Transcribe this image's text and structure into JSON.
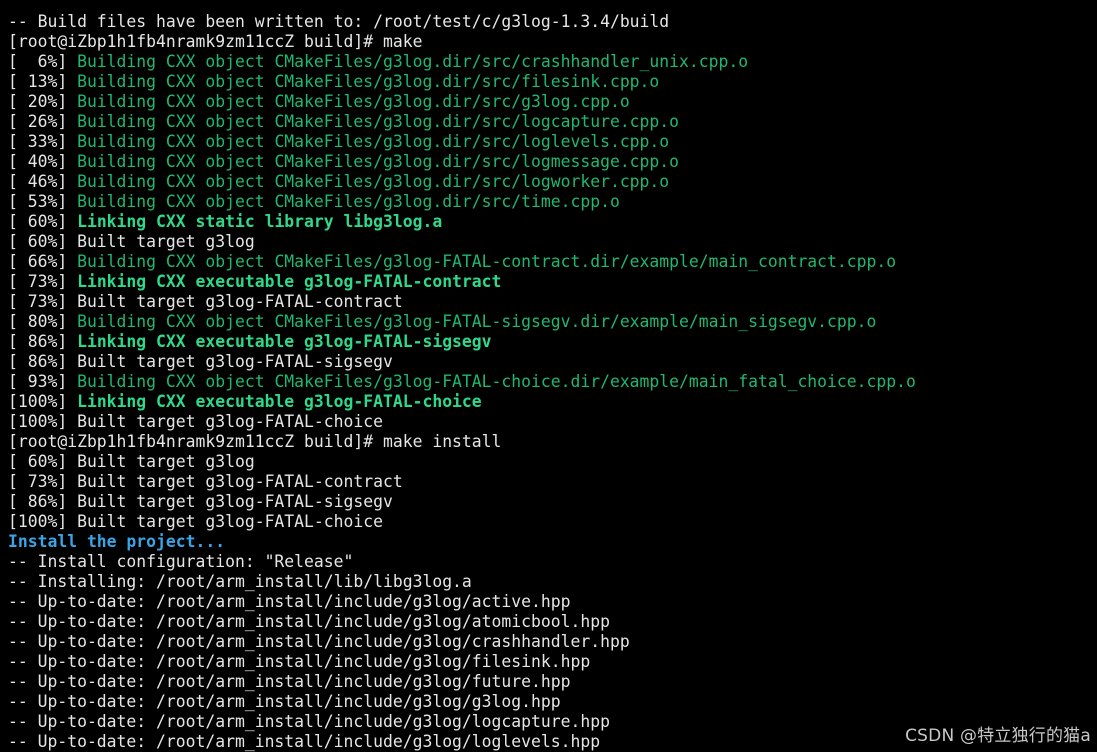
{
  "colors": {
    "background": "#000000",
    "normal": "#e6e6e6",
    "green": "#1fb870",
    "green_bold": "#2fd98a",
    "blue_bold": "#3aa5e6",
    "watermark": "#c8c8c8"
  },
  "watermark": "CSDN @特立独行的猫a",
  "lines": [
    {
      "segments": [
        {
          "text": "-- Build files have been written to: /root/test/c/g3log-1.3.4/build",
          "style": "normal"
        }
      ]
    },
    {
      "segments": [
        {
          "text": "[root@iZbp1h1fb4nramk9zm11ccZ build]# make",
          "style": "normal"
        }
      ]
    },
    {
      "segments": [
        {
          "text": "[  6%] ",
          "style": "normal"
        },
        {
          "text": "Building CXX object CMakeFiles/g3log.dir/src/crashhandler_unix.cpp.o",
          "style": "green"
        }
      ]
    },
    {
      "segments": [
        {
          "text": "[ 13%] ",
          "style": "normal"
        },
        {
          "text": "Building CXX object CMakeFiles/g3log.dir/src/filesink.cpp.o",
          "style": "green"
        }
      ]
    },
    {
      "segments": [
        {
          "text": "[ 20%] ",
          "style": "normal"
        },
        {
          "text": "Building CXX object CMakeFiles/g3log.dir/src/g3log.cpp.o",
          "style": "green"
        }
      ]
    },
    {
      "segments": [
        {
          "text": "[ 26%] ",
          "style": "normal"
        },
        {
          "text": "Building CXX object CMakeFiles/g3log.dir/src/logcapture.cpp.o",
          "style": "green"
        }
      ]
    },
    {
      "segments": [
        {
          "text": "[ 33%] ",
          "style": "normal"
        },
        {
          "text": "Building CXX object CMakeFiles/g3log.dir/src/loglevels.cpp.o",
          "style": "green"
        }
      ]
    },
    {
      "segments": [
        {
          "text": "[ 40%] ",
          "style": "normal"
        },
        {
          "text": "Building CXX object CMakeFiles/g3log.dir/src/logmessage.cpp.o",
          "style": "green"
        }
      ]
    },
    {
      "segments": [
        {
          "text": "[ 46%] ",
          "style": "normal"
        },
        {
          "text": "Building CXX object CMakeFiles/g3log.dir/src/logworker.cpp.o",
          "style": "green"
        }
      ]
    },
    {
      "segments": [
        {
          "text": "[ 53%] ",
          "style": "normal"
        },
        {
          "text": "Building CXX object CMakeFiles/g3log.dir/src/time.cpp.o",
          "style": "green"
        }
      ]
    },
    {
      "segments": [
        {
          "text": "[ 60%] ",
          "style": "normal"
        },
        {
          "text": "Linking CXX static library libg3log.a",
          "style": "green-bold"
        }
      ]
    },
    {
      "segments": [
        {
          "text": "[ 60%] Built target g3log",
          "style": "normal"
        }
      ]
    },
    {
      "segments": [
        {
          "text": "[ 66%] ",
          "style": "normal"
        },
        {
          "text": "Building CXX object CMakeFiles/g3log-FATAL-contract.dir/example/main_contract.cpp.o",
          "style": "green"
        }
      ]
    },
    {
      "segments": [
        {
          "text": "[ 73%] ",
          "style": "normal"
        },
        {
          "text": "Linking CXX executable g3log-FATAL-contract",
          "style": "green-bold"
        }
      ]
    },
    {
      "segments": [
        {
          "text": "[ 73%] Built target g3log-FATAL-contract",
          "style": "normal"
        }
      ]
    },
    {
      "segments": [
        {
          "text": "[ 80%] ",
          "style": "normal"
        },
        {
          "text": "Building CXX object CMakeFiles/g3log-FATAL-sigsegv.dir/example/main_sigsegv.cpp.o",
          "style": "green"
        }
      ]
    },
    {
      "segments": [
        {
          "text": "[ 86%] ",
          "style": "normal"
        },
        {
          "text": "Linking CXX executable g3log-FATAL-sigsegv",
          "style": "green-bold"
        }
      ]
    },
    {
      "segments": [
        {
          "text": "[ 86%] Built target g3log-FATAL-sigsegv",
          "style": "normal"
        }
      ]
    },
    {
      "segments": [
        {
          "text": "[ 93%] ",
          "style": "normal"
        },
        {
          "text": "Building CXX object CMakeFiles/g3log-FATAL-choice.dir/example/main_fatal_choice.cpp.o",
          "style": "green"
        }
      ]
    },
    {
      "segments": [
        {
          "text": "[100%] ",
          "style": "normal"
        },
        {
          "text": "Linking CXX executable g3log-FATAL-choice",
          "style": "green-bold"
        }
      ]
    },
    {
      "segments": [
        {
          "text": "[100%] Built target g3log-FATAL-choice",
          "style": "normal"
        }
      ]
    },
    {
      "segments": [
        {
          "text": "[root@iZbp1h1fb4nramk9zm11ccZ build]# make install",
          "style": "normal"
        }
      ]
    },
    {
      "segments": [
        {
          "text": "[ 60%] Built target g3log",
          "style": "normal"
        }
      ]
    },
    {
      "segments": [
        {
          "text": "[ 73%] Built target g3log-FATAL-contract",
          "style": "normal"
        }
      ]
    },
    {
      "segments": [
        {
          "text": "[ 86%] Built target g3log-FATAL-sigsegv",
          "style": "normal"
        }
      ]
    },
    {
      "segments": [
        {
          "text": "[100%] Built target g3log-FATAL-choice",
          "style": "normal"
        }
      ]
    },
    {
      "segments": [
        {
          "text": "Install the project...",
          "style": "blue-bold"
        }
      ]
    },
    {
      "segments": [
        {
          "text": "-- Install configuration: \"Release\"",
          "style": "normal"
        }
      ]
    },
    {
      "segments": [
        {
          "text": "-- Installing: /root/arm_install/lib/libg3log.a",
          "style": "normal"
        }
      ]
    },
    {
      "segments": [
        {
          "text": "-- Up-to-date: /root/arm_install/include/g3log/active.hpp",
          "style": "normal"
        }
      ]
    },
    {
      "segments": [
        {
          "text": "-- Up-to-date: /root/arm_install/include/g3log/atomicbool.hpp",
          "style": "normal"
        }
      ]
    },
    {
      "segments": [
        {
          "text": "-- Up-to-date: /root/arm_install/include/g3log/crashhandler.hpp",
          "style": "normal"
        }
      ]
    },
    {
      "segments": [
        {
          "text": "-- Up-to-date: /root/arm_install/include/g3log/filesink.hpp",
          "style": "normal"
        }
      ]
    },
    {
      "segments": [
        {
          "text": "-- Up-to-date: /root/arm_install/include/g3log/future.hpp",
          "style": "normal"
        }
      ]
    },
    {
      "segments": [
        {
          "text": "-- Up-to-date: /root/arm_install/include/g3log/g3log.hpp",
          "style": "normal"
        }
      ]
    },
    {
      "segments": [
        {
          "text": "-- Up-to-date: /root/arm_install/include/g3log/logcapture.hpp",
          "style": "normal"
        }
      ]
    },
    {
      "segments": [
        {
          "text": "-- Up-to-date: /root/arm_install/include/g3log/loglevels.hpp",
          "style": "normal"
        }
      ]
    }
  ]
}
